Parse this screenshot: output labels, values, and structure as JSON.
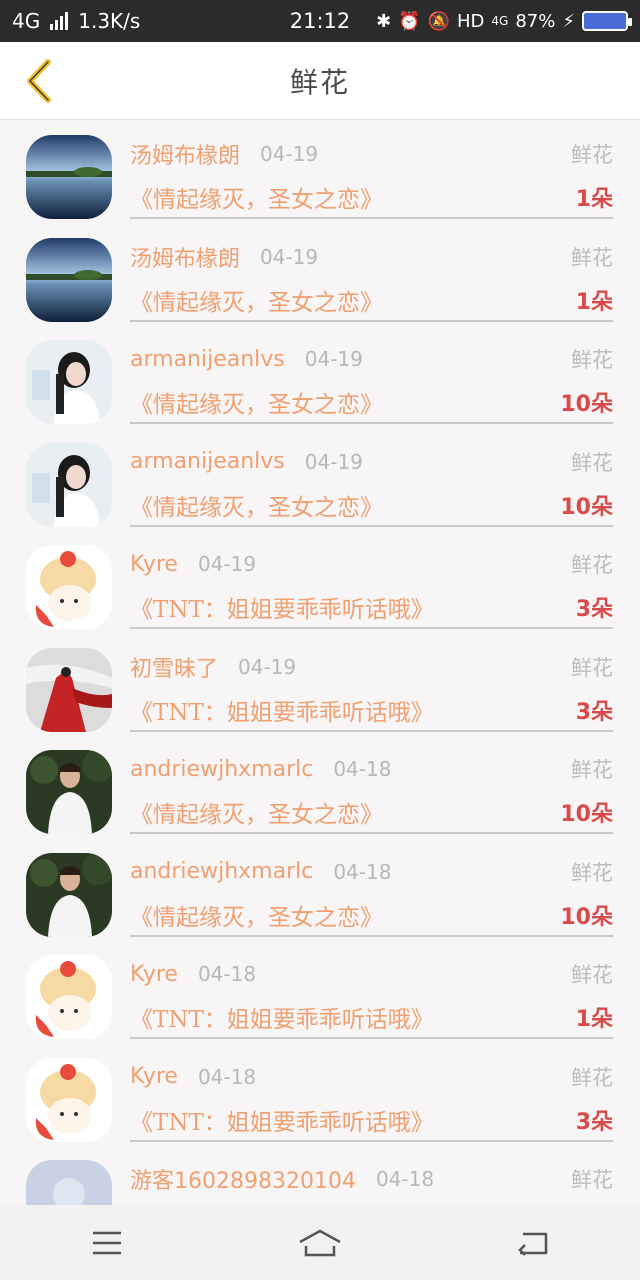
{
  "status_bar": {
    "network": "4G",
    "speed": "1.3K/s",
    "time": "21:12",
    "hd": "HD",
    "net_small": "4G",
    "battery": "87%",
    "icons": [
      "signal-icon",
      "bluetooth-icon",
      "alarm-icon",
      "mute-icon",
      "charging-icon",
      "battery-icon"
    ]
  },
  "header": {
    "title": "鲜花",
    "back_icon": "chevron-left-icon"
  },
  "gift_label": "鲜花",
  "rows": [
    {
      "user": "汤姆布椽朗",
      "date": "04-19",
      "book": "《情起缘灭，圣女之恋》",
      "count": "1朵",
      "avatar": "landscape"
    },
    {
      "user": "汤姆布椽朗",
      "date": "04-19",
      "book": "《情起缘灭，圣女之恋》",
      "count": "1朵",
      "avatar": "landscape"
    },
    {
      "user": "armanijeanlvs",
      "date": "04-19",
      "book": "《情起缘灭，圣女之恋》",
      "count": "10朵",
      "avatar": "girl"
    },
    {
      "user": "armanijeanlvs",
      "date": "04-19",
      "book": "《情起缘灭，圣女之恋》",
      "count": "10朵",
      "avatar": "girl"
    },
    {
      "user": "Kyre",
      "date": "04-19",
      "book": "《TNT：姐姐要乖乖听话哦》",
      "count": "3朵",
      "avatar": "lion"
    },
    {
      "user": "初雪昧了",
      "date": "04-19",
      "book": "《TNT：姐姐要乖乖听话哦》",
      "count": "3朵",
      "avatar": "red"
    },
    {
      "user": "andriewjhxmarlc",
      "date": "04-18",
      "book": "《情起缘灭，圣女之恋》",
      "count": "10朵",
      "avatar": "man"
    },
    {
      "user": "andriewjhxmarlc",
      "date": "04-18",
      "book": "《情起缘灭，圣女之恋》",
      "count": "10朵",
      "avatar": "man"
    },
    {
      "user": "Kyre",
      "date": "04-18",
      "book": "《TNT：姐姐要乖乖听话哦》",
      "count": "1朵",
      "avatar": "lion"
    },
    {
      "user": "Kyre",
      "date": "04-18",
      "book": "《TNT：姐姐要乖乖听话哦》",
      "count": "3朵",
      "avatar": "lion"
    },
    {
      "user": "游客1602898320104",
      "date": "04-18",
      "book": "",
      "count": "",
      "avatar": "default"
    }
  ],
  "nav": {
    "icons": [
      "menu-icon",
      "home-icon",
      "back-icon"
    ]
  },
  "colors": {
    "accent": "#f0a070",
    "count": "#d94a4a",
    "back_icon": "#f2c12e"
  }
}
